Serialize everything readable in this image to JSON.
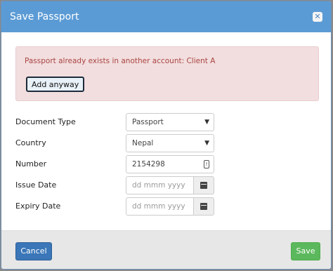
{
  "header": {
    "title": "Save Passport",
    "close_icon": "close-icon"
  },
  "alert": {
    "message": "Passport already exists in another account: Client A",
    "button_label": "Add anyway"
  },
  "form": {
    "document_type": {
      "label": "Document Type",
      "value": "Passport"
    },
    "country": {
      "label": "Country",
      "value": "Nepal"
    },
    "number": {
      "label": "Number",
      "value": "2154298"
    },
    "issue_date": {
      "label": "Issue Date",
      "placeholder": "dd mmm yyyy"
    },
    "expiry_date": {
      "label": "Expiry Date",
      "placeholder": "dd mmm yyyy"
    }
  },
  "footer": {
    "cancel_label": "Cancel",
    "save_label": "Save"
  },
  "colors": {
    "header": "#5b9bd5",
    "alert_bg": "#f2dede",
    "alert_text": "#a94442",
    "cancel": "#3a76b8",
    "save": "#5cb85c"
  }
}
